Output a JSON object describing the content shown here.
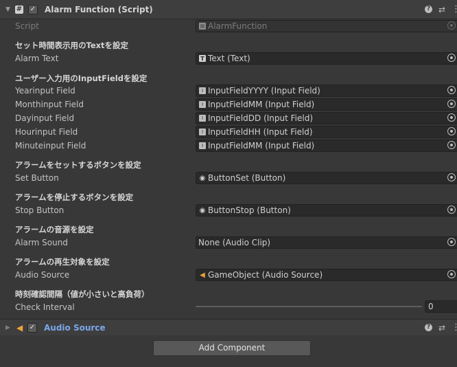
{
  "component": {
    "title": "Alarm Function (Script)",
    "script_label": "Script",
    "script_value": "AlarmFunction"
  },
  "sections": {
    "text": "セット時間表示用のTextを設定",
    "input": "ユーザー入力用のInputFieldを設定",
    "set_button": "アラームをセットするボタンを設定",
    "stop_button": "アラームを停止するボタンを設定",
    "sound": "アラームの音源を設定",
    "source": "アラームの再生対象を設定",
    "interval": "時刻確認間隔（値が小さいと高負荷）"
  },
  "fields": {
    "alarm_text": {
      "label": "Alarm Text",
      "value": "Text (Text)"
    },
    "year": {
      "label": "Yearinput Field",
      "value": "InputFieldYYYY (Input Field)"
    },
    "month": {
      "label": "Monthinput Field",
      "value": "InputFieldMM (Input Field)"
    },
    "day": {
      "label": "Dayinput Field",
      "value": "InputFieldDD (Input Field)"
    },
    "hour": {
      "label": "Hourinput Field",
      "value": "InputFieldHH (Input Field)"
    },
    "minute": {
      "label": "Minuteinput Field",
      "value": "InputFieldMM (Input Field)"
    },
    "set_button": {
      "label": "Set Button",
      "value": "ButtonSet (Button)"
    },
    "stop_button": {
      "label": "Stop Button",
      "value": "ButtonStop (Button)"
    },
    "alarm_sound": {
      "label": "Alarm Sound",
      "value": "None (Audio Clip)"
    },
    "audio_source": {
      "label": "Audio Source",
      "value": "GameObject (Audio Source)"
    },
    "check_interval": {
      "label": "Check Interval",
      "value": "0"
    }
  },
  "audio_component": {
    "title": "Audio Source"
  },
  "add_component_label": "Add Component",
  "icons": {
    "help": "?",
    "presets": "⇄",
    "menu": "⋮",
    "check": "✓",
    "script": "#"
  },
  "colors": {
    "background": "#383838",
    "header": "#3e3e3e",
    "field": "#2a2a2a",
    "link_title": "#7aa7ea",
    "audio_icon": "#f0a23a"
  }
}
